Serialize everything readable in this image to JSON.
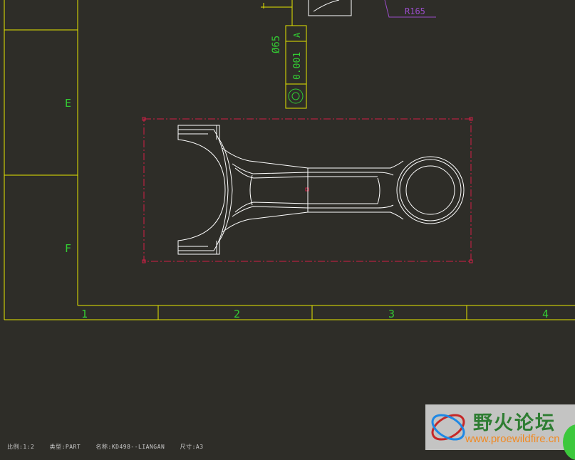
{
  "drawing": {
    "zone_rows": [
      "E",
      "F"
    ],
    "zone_cols": [
      "1",
      "2",
      "3",
      "4"
    ],
    "radius_label": "R165",
    "diameter_label": "Ø65",
    "tolerance": {
      "symbol": "concentricity-icon",
      "value": "0.001",
      "datum": "A"
    }
  },
  "status_bar": {
    "scale": "比例:1:2",
    "type": "类型:PART",
    "name": "名称:KD498--LIANGAN",
    "size": "尺寸:A3"
  },
  "watermark": {
    "title": "野火论坛",
    "url": "www.proewildfire.cn"
  },
  "colors": {
    "background": "#2e2d28",
    "border": "#e6e600",
    "zone_text": "#33cc33",
    "geometry": "#ffffff",
    "selection": "#d21e46",
    "annotation": "#9b4dca"
  }
}
